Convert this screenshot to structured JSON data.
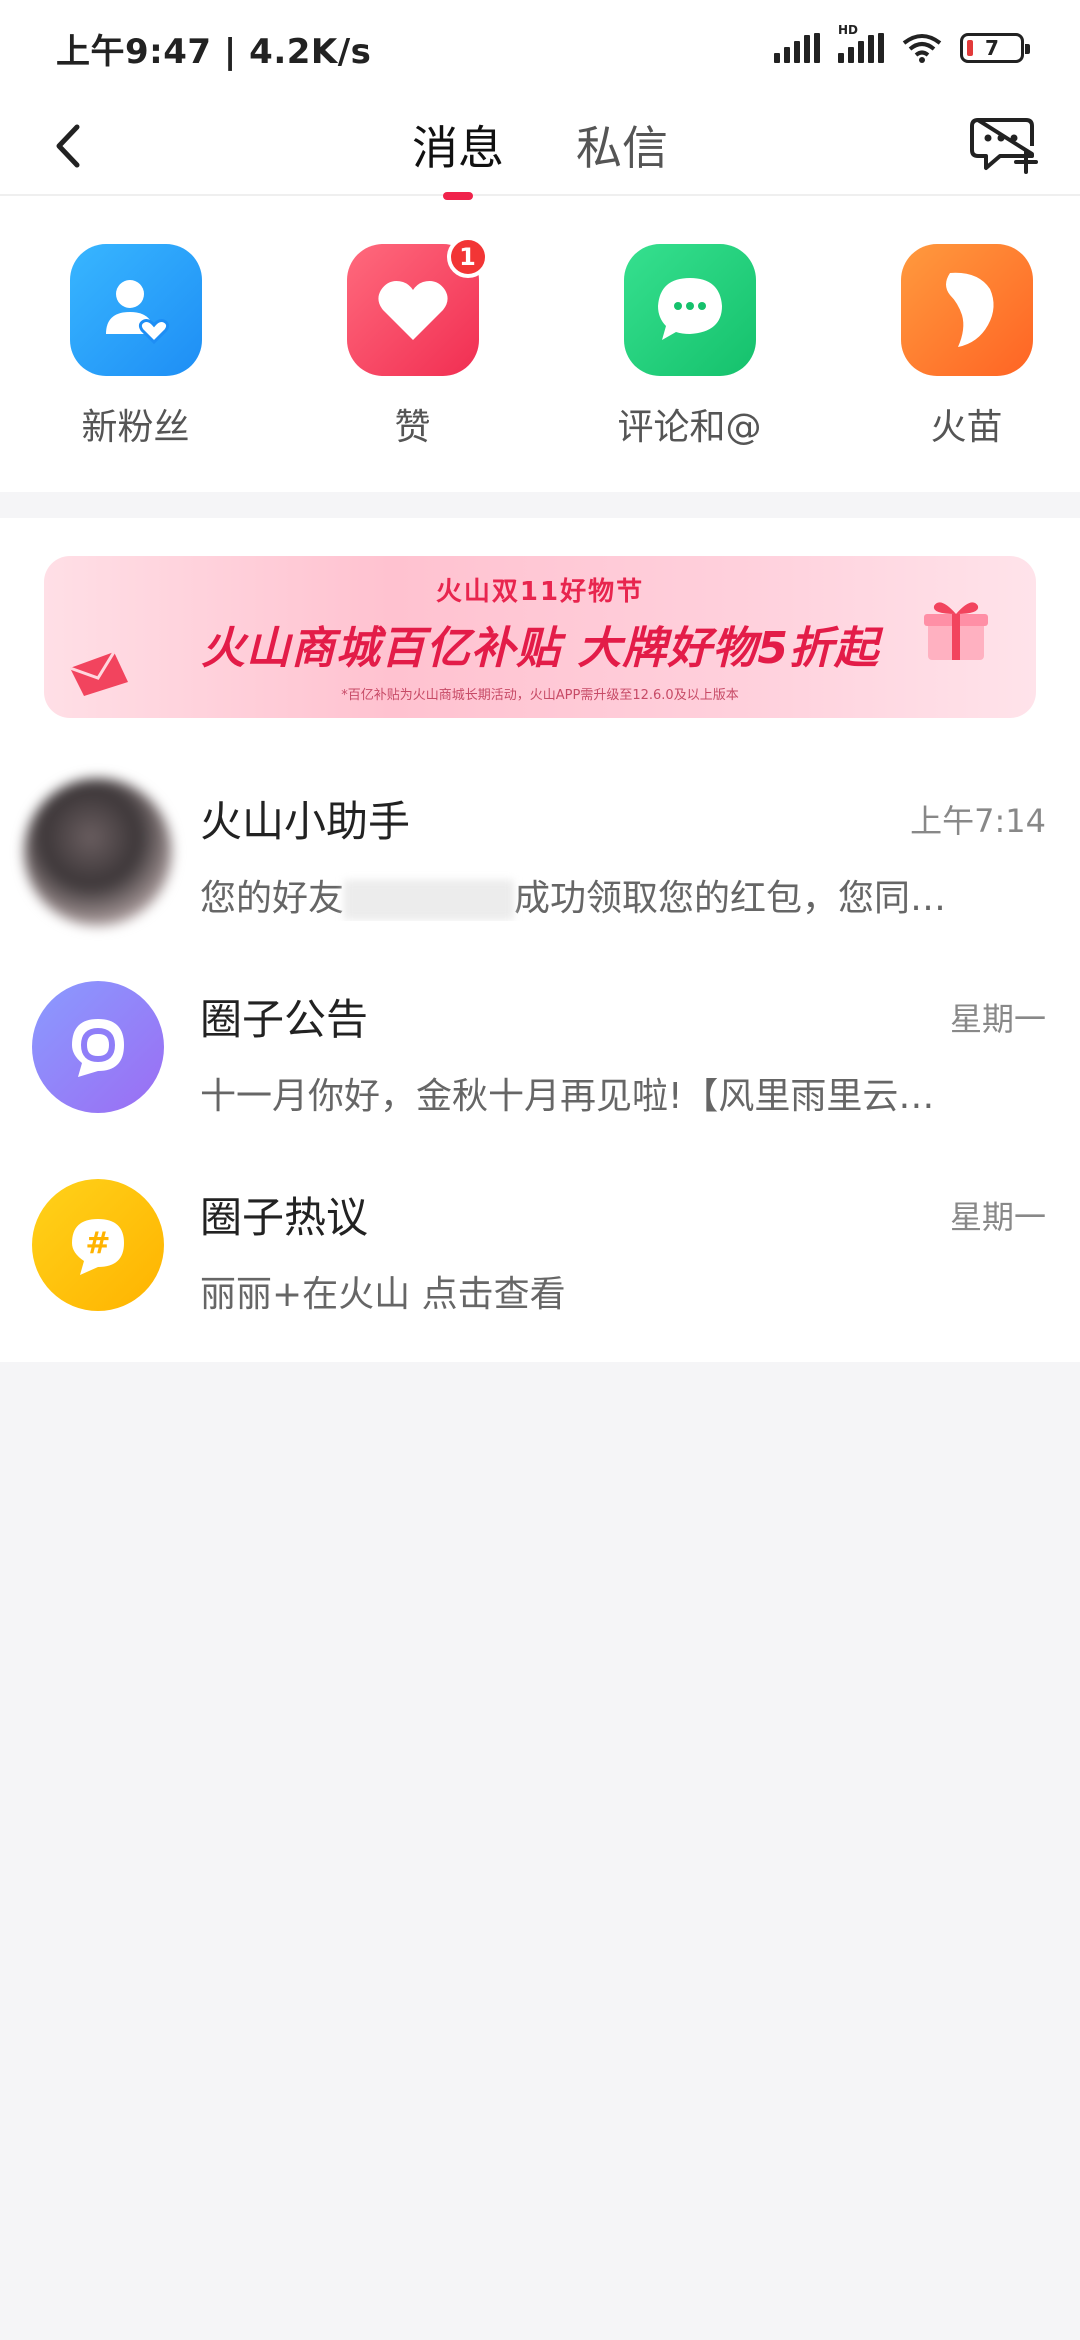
{
  "status_bar": {
    "time_speed": "上午9:47 | 4.2K/s",
    "battery": "7",
    "hd": "HD"
  },
  "nav": {
    "tabs": [
      {
        "label": "消息",
        "active": true
      },
      {
        "label": "私信",
        "active": false
      }
    ]
  },
  "categories": [
    {
      "label": "新粉丝",
      "icon": "new-follower-icon",
      "color": "#1e8ef5"
    },
    {
      "label": "赞",
      "icon": "heart-icon",
      "color": "#f12e52",
      "badge": "1"
    },
    {
      "label": "评论和@",
      "icon": "comment-bubble-icon",
      "color": "#15c16c"
    },
    {
      "label": "火苗",
      "icon": "flame-icon",
      "color": "#ff6424"
    }
  ],
  "banner": {
    "subtitle": "火山双11好物节",
    "title": "火山商城百亿补贴 大牌好物5折起",
    "note": "*百亿补贴为火山商城长期活动，火山APP需升级至12.6.0及以上版本"
  },
  "messages": [
    {
      "title": "火山小助手",
      "time": "上午7:14",
      "preview_start": "您的好友",
      "preview_end": "成功领取您的红包，您同…"
    },
    {
      "title": "圈子公告",
      "time": "星期一",
      "preview": "十一月你好，金秋十月再见啦!【风里雨里云…"
    },
    {
      "title": "圈子热议",
      "time": "星期一",
      "preview": "丽丽+在火山 点击查看",
      "avatar_symbol": "#"
    }
  ],
  "colors": {
    "accent": "#f0234b",
    "background": "#f5f5f7"
  }
}
